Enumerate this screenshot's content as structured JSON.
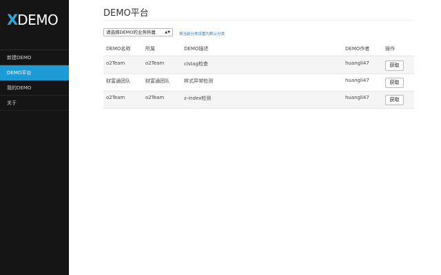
{
  "app": {
    "logo_mark": "X",
    "logo_text": "DEMO"
  },
  "sidebar": {
    "items": [
      {
        "label": "新建DEMO",
        "active": false
      },
      {
        "label": "DEMO平台",
        "active": true
      },
      {
        "label": "我的DEMO",
        "active": false
      },
      {
        "label": "关于",
        "active": false
      }
    ]
  },
  "main": {
    "title": "DEMO平台",
    "category_select": {
      "value": "请选择DEMO的业务所属",
      "arrow": "▲▼"
    },
    "set_default_link": "将当前分类设置为默认分类",
    "table": {
      "headers": [
        "DEMO名称",
        "所属",
        "DEMO描述",
        "DEMO作者",
        "操作"
      ],
      "rows": [
        {
          "name": "o2Team",
          "belongs": "o2Team",
          "desc": "clstag检查",
          "author": "huangli47",
          "action": "获取"
        },
        {
          "name": "财富通团队",
          "belongs": "财富通团队",
          "desc": "样式异常检测",
          "author": "huangli47",
          "action": "获取"
        },
        {
          "name": "o2Team",
          "belongs": "o2Team",
          "desc": "z-index检测",
          "author": "huangli47",
          "action": "获取"
        }
      ]
    }
  },
  "colors": {
    "sidebar_bg": "#151515",
    "accent": "#1d9bd6",
    "logo_mark": "#2aa8dc",
    "link": "#2a6fb0"
  }
}
